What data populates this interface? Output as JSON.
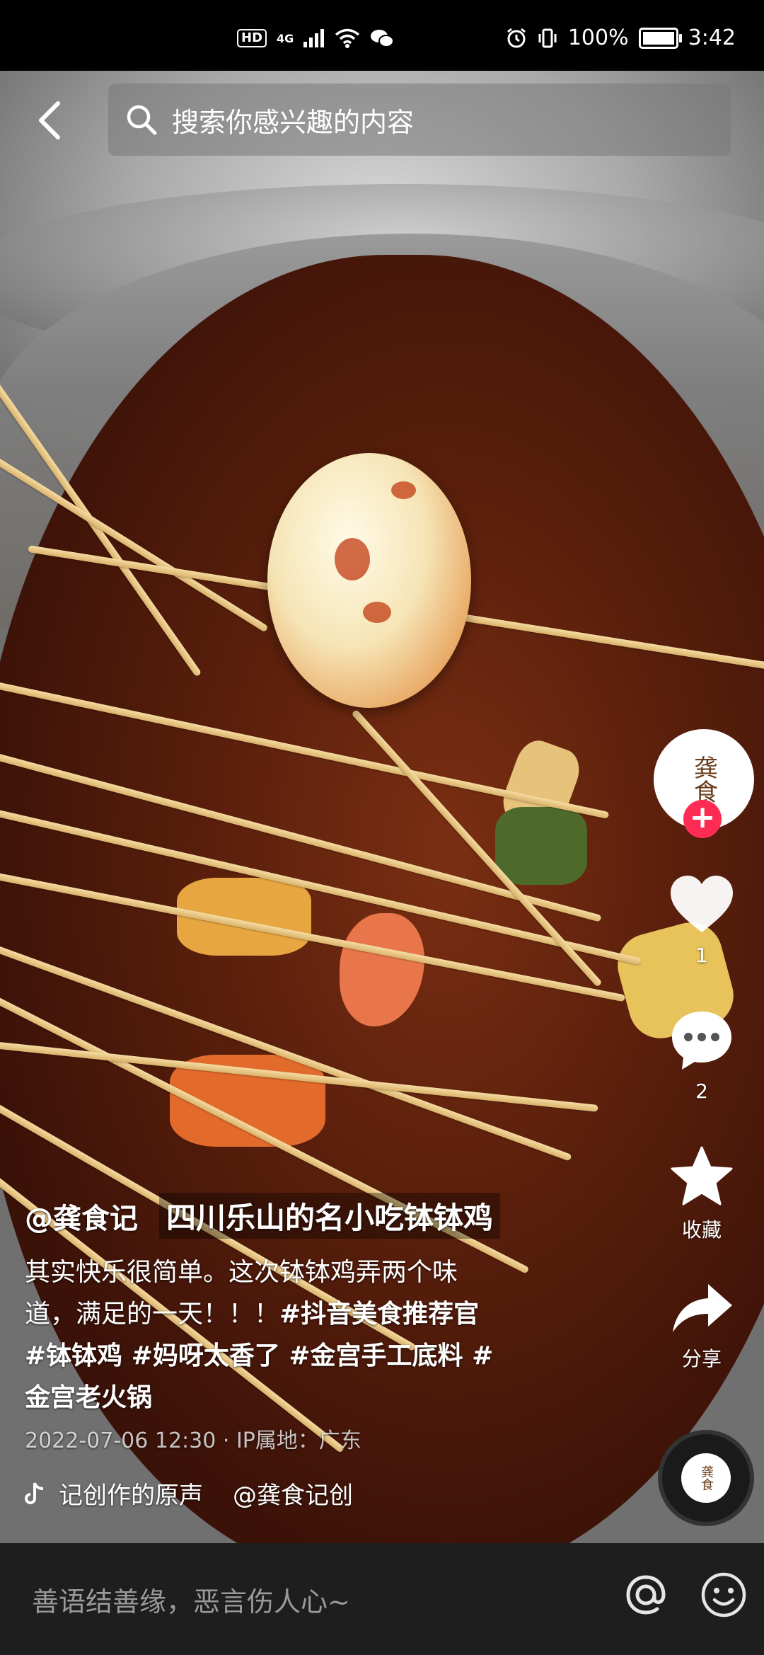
{
  "status_bar": {
    "hd": "HD",
    "network": "4G",
    "battery": "100%",
    "battery_level": 1.0,
    "time": "3:42"
  },
  "search": {
    "placeholder": "搜索你感兴趣的内容"
  },
  "avatar": {
    "text": "龚食"
  },
  "actions": {
    "likes": "1",
    "comments": "2",
    "favorite_label": "收藏",
    "share_label": "分享"
  },
  "caption": {
    "author": "@龚食记",
    "title": "四川乐山的名小吃钵钵鸡",
    "desc_line1": "其实快乐很简单。这次钵钵鸡弄两个味",
    "desc_line2_text": "道，满足的一天！！！",
    "desc_line2_tag": "#抖音美食推荐官",
    "desc_line3": "#钵钵鸡 #妈呀太香了 #金宫手工底料 #",
    "desc_line4": "金宫老火锅",
    "meta": "2022-07-06 12:30 · IP属地：广东"
  },
  "music": {
    "sound": "记创作的原声",
    "author": "@龚食记创"
  },
  "comment_bar": {
    "hint": "善语结善缘，恶言伤人心~"
  },
  "icons": [
    "back-arrow-icon",
    "search-icon",
    "heart-icon",
    "comment-icon",
    "star-icon",
    "share-icon",
    "tiktok-note-icon",
    "at-icon",
    "emoji-icon"
  ]
}
